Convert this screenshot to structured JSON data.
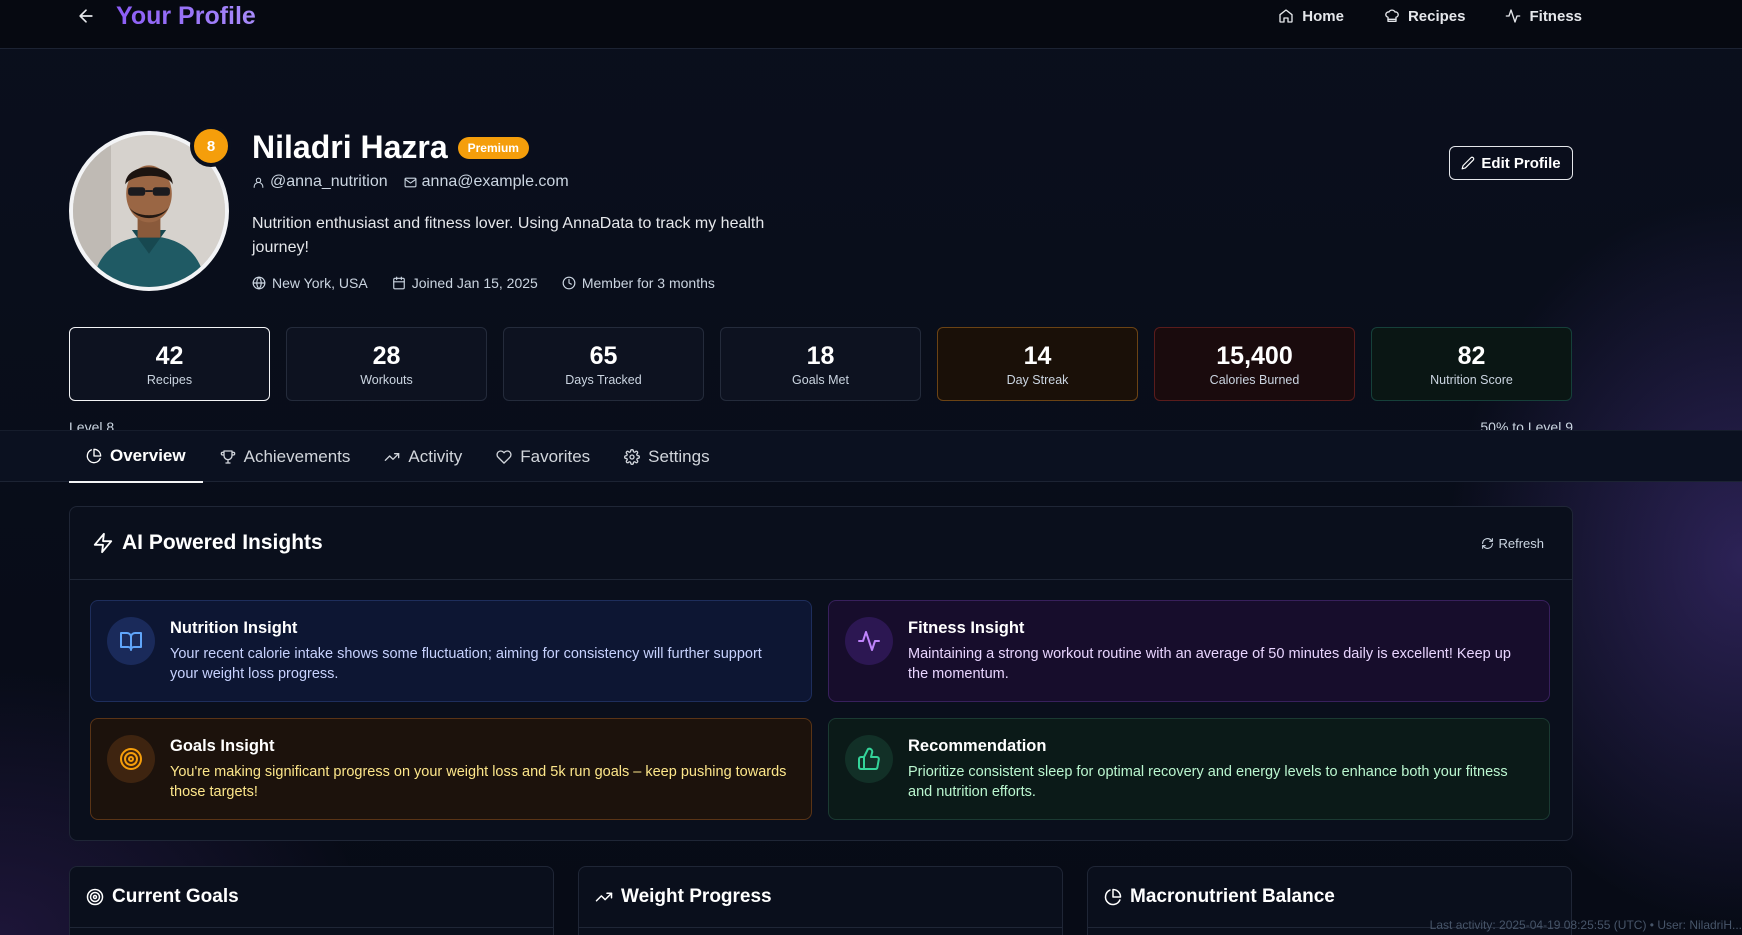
{
  "header": {
    "title": "Your Profile",
    "nav": [
      {
        "label": "Home",
        "icon": "home-icon"
      },
      {
        "label": "Recipes",
        "icon": "chef-hat-icon"
      },
      {
        "label": "Fitness",
        "icon": "activity-icon"
      }
    ]
  },
  "profile": {
    "level_badge": "8",
    "name": "Niladri Hazra",
    "badge": "Premium",
    "username": "@anna_nutrition",
    "email": "anna@example.com",
    "bio": "Nutrition enthusiast and fitness lover. Using AnnaData to track my health journey!",
    "location": "New York, USA",
    "joined": "Joined Jan 15, 2025",
    "member_for": "Member for 3 months",
    "edit_label": "Edit Profile"
  },
  "stats": [
    {
      "value": "42",
      "label": "Recipes"
    },
    {
      "value": "28",
      "label": "Workouts"
    },
    {
      "value": "65",
      "label": "Days Tracked"
    },
    {
      "value": "18",
      "label": "Goals Met"
    },
    {
      "value": "14",
      "label": "Day Streak"
    },
    {
      "value": "15,400",
      "label": "Calories Burned"
    },
    {
      "value": "82",
      "label": "Nutrition Score"
    }
  ],
  "level": {
    "current": "Level 8",
    "next": "50% to Level 9",
    "progress_percent": 50
  },
  "tabs": [
    {
      "label": "Overview",
      "icon": "pie-chart-icon"
    },
    {
      "label": "Achievements",
      "icon": "trophy-icon"
    },
    {
      "label": "Activity",
      "icon": "trending-up-icon"
    },
    {
      "label": "Favorites",
      "icon": "heart-icon"
    },
    {
      "label": "Settings",
      "icon": "gear-icon"
    }
  ],
  "insights": {
    "title": "AI Powered Insights",
    "refresh_label": "Refresh",
    "cards": [
      {
        "title": "Nutrition Insight",
        "body": "Your recent calorie intake shows some fluctuation; aiming for consistency will further support your weight loss progress.",
        "icon": "book-open-icon",
        "color": "#60a5fa"
      },
      {
        "title": "Fitness Insight",
        "body": "Maintaining a strong workout routine with an average of 50 minutes daily is excellent! Keep up the momentum.",
        "icon": "activity-icon",
        "color": "#c084fc"
      },
      {
        "title": "Goals Insight",
        "body": "You're making significant progress on your weight loss and 5k run goals – keep pushing towards those targets!",
        "icon": "target-icon",
        "color": "#f59e0b"
      },
      {
        "title": "Recommendation",
        "body": "Prioritize consistent sleep for optimal recovery and energy levels to enhance both your fitness and nutrition efforts.",
        "icon": "thumbs-up-icon",
        "color": "#34d399"
      }
    ]
  },
  "sections": [
    {
      "title": "Current Goals",
      "icon": "target-icon"
    },
    {
      "title": "Weight Progress",
      "icon": "trending-up-icon"
    },
    {
      "title": "Macronutrient Balance",
      "icon": "pie-chart-icon"
    }
  ],
  "footer": "Last activity: 2025-04-19 08:25:55 (UTC) • User: NiladriH..."
}
